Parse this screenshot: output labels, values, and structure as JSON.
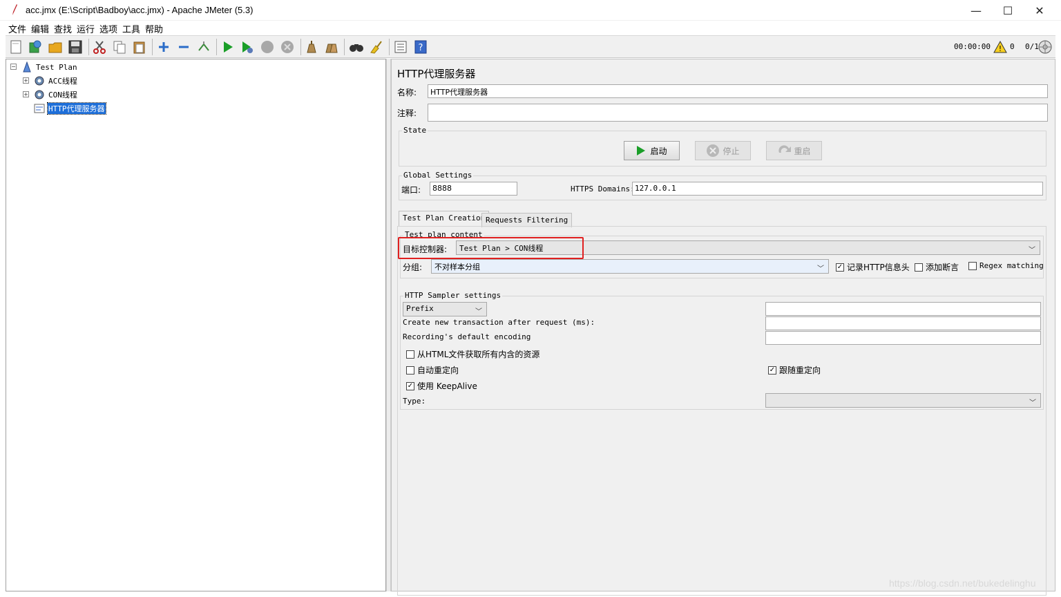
{
  "window": {
    "title": "acc.jmx (E:\\Script\\Badboy\\acc.jmx) - Apache JMeter (5.3)",
    "minimize_glyph": "—",
    "maximize_glyph": "☐",
    "close_glyph": "✕"
  },
  "menu": [
    "文件",
    "编辑",
    "查找",
    "运行",
    "选项",
    "工具",
    "帮助"
  ],
  "toolbar": {
    "timer": "00:00:00",
    "warnings": "0",
    "threads": "0/1",
    "icons": [
      "new-icon",
      "templates-icon",
      "open-icon",
      "save-icon",
      "cut-icon",
      "copy-icon",
      "paste-icon",
      "expand-icon",
      "collapse-icon",
      "toggle-icon",
      "start-icon",
      "start-no-pause-icon",
      "stop-icon",
      "shutdown-icon",
      "clear-icon",
      "clear-all-icon",
      "search-icon",
      "reset-search-icon",
      "function-helper-icon",
      "help-icon"
    ]
  },
  "tree": {
    "root": "Test Plan",
    "items": [
      "ACC线程",
      "CON线程",
      "HTTP代理服务器"
    ],
    "selected": "HTTP代理服务器"
  },
  "proxy": {
    "heading": "HTTP代理服务器",
    "name_label": "名称:",
    "name_value": "HTTP代理服务器",
    "comment_label": "注释:",
    "comment_value": "",
    "state": {
      "title": "State",
      "start": "启动",
      "stop": "停止",
      "restart": "重启"
    },
    "global": {
      "title": "Global Settings",
      "port_label": "端口:",
      "port_value": "8888",
      "https_label": "HTTPS Domains:",
      "https_value": "127.0.0.1"
    },
    "tabs": [
      "Test Plan Creation",
      "Requests Filtering"
    ],
    "content": {
      "title": "Test plan content",
      "target_label": "目标控制器:",
      "target_value": "Test Plan > CON线程",
      "group_label": "分组:",
      "group_value": "不对样本分组",
      "record_http_headers": "记录HTTP信息头",
      "add_assertions": "添加断言",
      "regex_matching": "Regex matching"
    },
    "sampler": {
      "title": "HTTP Sampler settings",
      "prefix_option": "Prefix",
      "transaction_label": "Create new transaction after request (ms):",
      "encoding_label": "Recording's default encoding",
      "retrieve_resources": "从HTML文件获取所有内含的资源",
      "auto_redirect": "自动重定向",
      "follow_redirect": "跟随重定向",
      "keepalive": "使用 KeepAlive",
      "type_label": "Type:",
      "type_value": ""
    }
  },
  "watermark": "https://blog.csdn.net/bukedelinghu",
  "colors": {
    "selection": "#1e6fd9",
    "highlight_box": "#e02020",
    "start_green": "#1a9e28"
  }
}
